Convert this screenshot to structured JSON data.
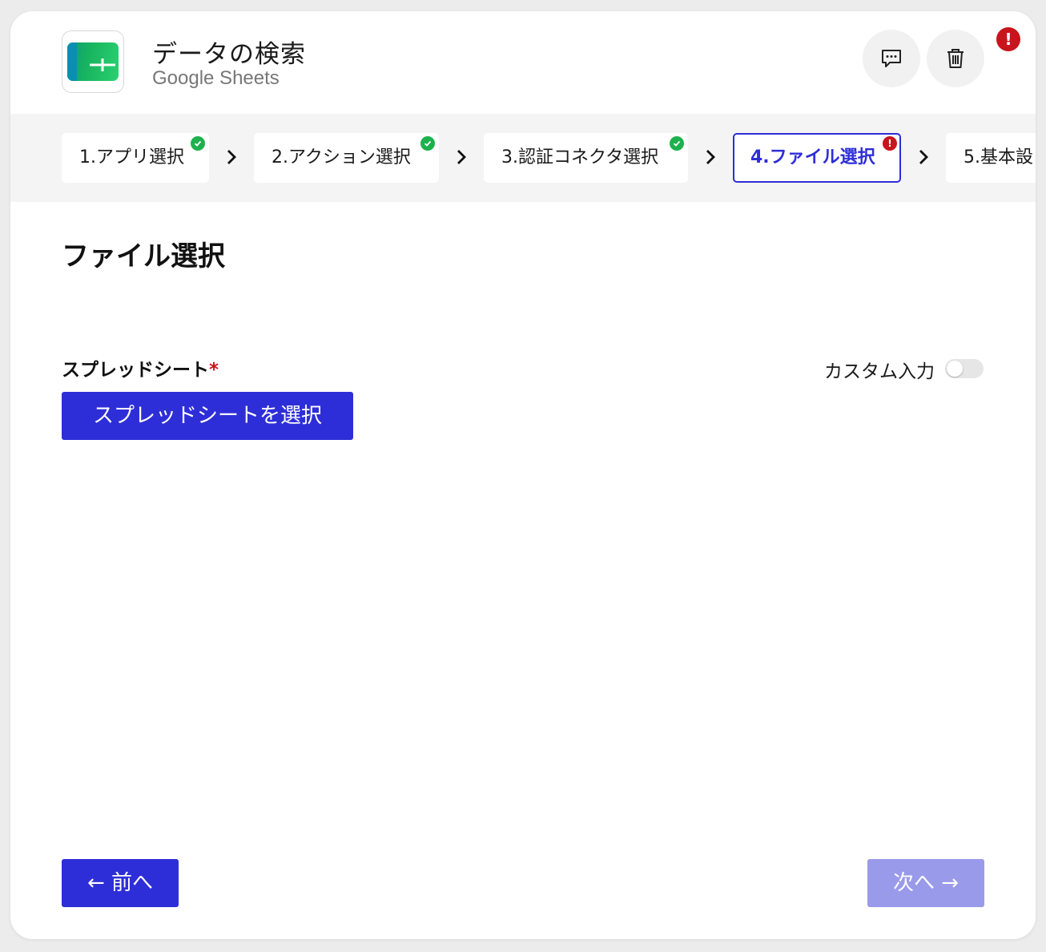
{
  "header": {
    "title": "データの検索",
    "subtitle": "Google Sheets",
    "logo_icon": "google-sheets-logo",
    "comment_icon": "comment-icon",
    "trash_icon": "trash-icon",
    "error_badge": "!"
  },
  "steps": [
    {
      "label": "1.アプリ選択",
      "status": "complete"
    },
    {
      "label": "2.アクション選択",
      "status": "complete"
    },
    {
      "label": "3.認証コネクタ選択",
      "status": "complete"
    },
    {
      "label": "4.ファイル選択",
      "status": "error",
      "active": true
    },
    {
      "label": "5.基本設",
      "status": "pending"
    }
  ],
  "main": {
    "section_title": "ファイル選択",
    "field_label": "スプレッドシート",
    "required_mark": "*",
    "custom_input_label": "カスタム入力",
    "custom_input_enabled": false,
    "select_button": "スプレッドシートを選択"
  },
  "footer": {
    "prev_label": "← 前へ",
    "next_label": "次へ →"
  },
  "colors": {
    "accent": "#2e2ed8",
    "success": "#1db14e",
    "error": "#c8141c",
    "disabled": "#9a9aeb"
  }
}
